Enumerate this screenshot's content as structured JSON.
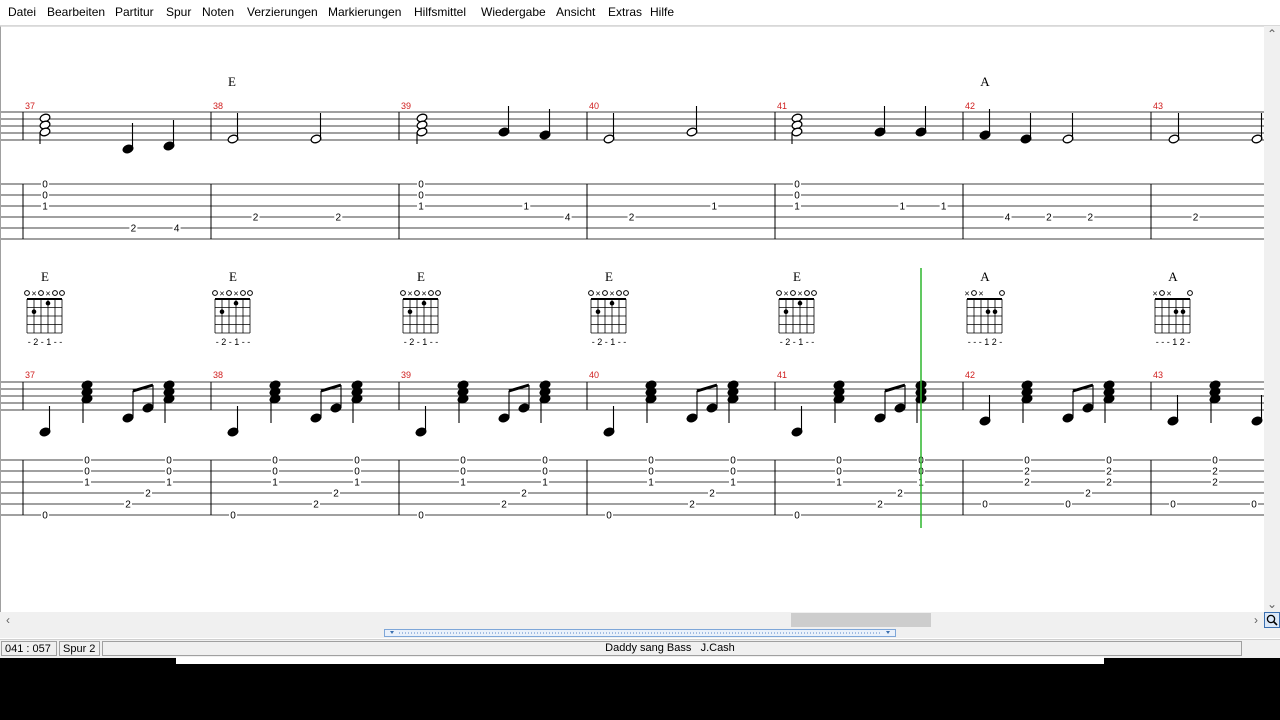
{
  "menu": [
    "Datei",
    "Bearbeiten",
    "Partitur",
    "Spur",
    "Noten",
    "Verzierungen",
    "Markierungen",
    "Hilfsmittel",
    "Wiedergabe",
    "Ansicht",
    "Extras",
    "Hilfe"
  ],
  "track1": {
    "measures": [
      "37",
      "38",
      "39",
      "40",
      "41",
      "42",
      "43"
    ],
    "chords": [
      {
        "m": 0,
        "name": "E"
      },
      {
        "m": 4,
        "name": "A"
      }
    ],
    "tab": [
      [
        [
          [
            0,
            1,
            "0"
          ],
          [
            0,
            2,
            "0"
          ],
          [
            0,
            3,
            "1"
          ]
        ],
        [
          [
            0.47,
            5,
            "2"
          ],
          [
            0.7,
            5,
            "4"
          ]
        ]
      ],
      [
        [
          [
            0.12,
            4,
            "2"
          ]
        ],
        [
          [
            0.56,
            4,
            "2"
          ]
        ]
      ],
      [
        [
          [
            0,
            1,
            "0"
          ],
          [
            0,
            2,
            "0"
          ],
          [
            0,
            3,
            "1"
          ]
        ],
        [
          [
            0.56,
            3,
            "1"
          ]
        ],
        [
          [
            0.78,
            4,
            "4"
          ]
        ]
      ],
      [
        [
          [
            0.12,
            4,
            "2"
          ]
        ],
        [
          [
            0.56,
            3,
            "1"
          ]
        ]
      ],
      [
        [
          [
            0,
            1,
            "0"
          ],
          [
            0,
            2,
            "0"
          ],
          [
            0,
            3,
            "1"
          ]
        ],
        [
          [
            0.56,
            3,
            "1"
          ]
        ],
        [
          [
            0.78,
            3,
            "1"
          ]
        ]
      ],
      [
        [
          [
            0.12,
            4,
            "4"
          ]
        ],
        [
          [
            0.34,
            4,
            "2"
          ]
        ],
        [
          [
            0.56,
            4,
            "2"
          ]
        ]
      ],
      [
        [
          [
            0.12,
            4,
            "2"
          ]
        ],
        [
          [
            0.56,
            4,
            "2"
          ]
        ]
      ]
    ]
  },
  "track2": {
    "measures": [
      "37",
      "38",
      "39",
      "40",
      "41",
      "42",
      "43"
    ],
    "chords": [
      {
        "m": 0,
        "name": "E",
        "fingering": "- 2 - 1 - -"
      },
      {
        "m": 1,
        "name": "E",
        "fingering": "- 2 - 1 - -"
      },
      {
        "m": 2,
        "name": "E",
        "fingering": "- 2 - 1 - -"
      },
      {
        "m": 3,
        "name": "E",
        "fingering": "- 2 - 1 - -"
      },
      {
        "m": 4,
        "name": "E",
        "fingering": "- 2 - 1 - -"
      },
      {
        "m": 5,
        "name": "A",
        "fingering": "- - - 1 2 -"
      },
      {
        "m": 6,
        "name": "A",
        "fingering": "- - - 1 2 -"
      }
    ]
  },
  "status": {
    "position": "041 : 057",
    "track": "Spur 2",
    "song": "Daddy sang Bass",
    "artist": "J.Cash"
  },
  "colors": {
    "measure_number": "#d02020",
    "cursor": "#2db52d",
    "staff": "#000000"
  }
}
